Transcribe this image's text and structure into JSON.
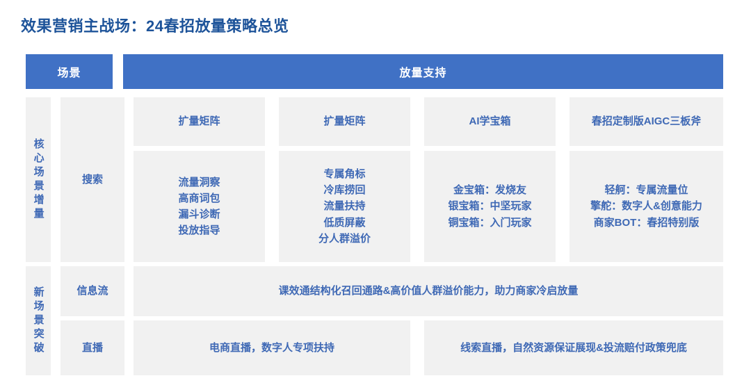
{
  "colors": {
    "title": "#1d5399",
    "header_bg": "#4071c5",
    "header_text": "#ffffff",
    "cell_bg": "#f1f1f1",
    "cell_text": "#3f69b5",
    "page_bg": "#ffffff"
  },
  "title": "效果营销主战场：24春招放量策略总览",
  "header": {
    "scene": "场景",
    "support": "放量支持"
  },
  "groups": {
    "core": "核心场景增量",
    "new": "新场景突破"
  },
  "channels": {
    "search": "搜索",
    "feed": "信息流",
    "live": "直播"
  },
  "core_columns": [
    {
      "title": "扩量矩阵",
      "body": "流量洞察\n高商词包\n漏斗诊断\n投放指导"
    },
    {
      "title": "扩量矩阵",
      "body": "专属角标\n冷库捞回\n流量扶持\n低质屏蔽\n分人群溢价"
    },
    {
      "title": "AI学宝箱",
      "body": "金宝箱：发烧友\n银宝箱：中坚玩家\n铜宝箱：入门玩家"
    },
    {
      "title": "春招定制版AIGC三板斧",
      "body": "轻舸：专属流量位\n擎舵：数字人&创意能力\n商家BOT：春招特别版"
    }
  ],
  "feed_row": {
    "content": "课效通结构化召回通路&高价值人群溢价能力，助力商家冷启放量"
  },
  "live_row": {
    "left": "电商直播，数字人专项扶持",
    "right": "线索直播，自然资源保证展现&投流赔付政策兜底"
  }
}
